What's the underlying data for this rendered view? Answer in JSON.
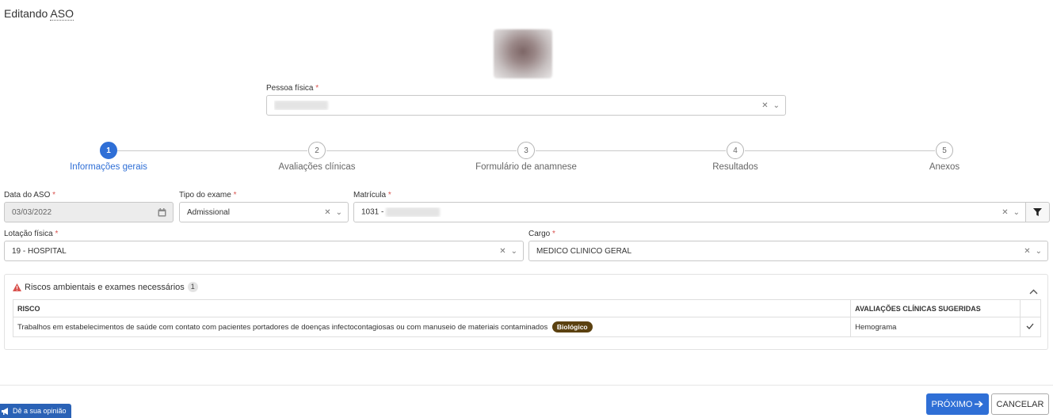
{
  "page": {
    "title_prefix": "Editando ",
    "title_acronym": "ASO"
  },
  "pessoa": {
    "label": "Pessoa física",
    "required": "*"
  },
  "steps": [
    {
      "number": "1",
      "label": "Informações gerais",
      "active": true
    },
    {
      "number": "2",
      "label": "Avaliações clínicas",
      "active": false
    },
    {
      "number": "3",
      "label": "Formulário de anamnese",
      "active": false
    },
    {
      "number": "4",
      "label": "Resultados",
      "active": false
    },
    {
      "number": "5",
      "label": "Anexos",
      "active": false
    }
  ],
  "form": {
    "data_aso": {
      "label": "Data do ASO",
      "value": "03/03/2022"
    },
    "tipo_exame": {
      "label": "Tipo do exame",
      "value": "Admissional"
    },
    "matricula": {
      "label": "Matrícula",
      "value": "1031 -"
    },
    "lotacao": {
      "label": "Lotação física",
      "value": "19 - HOSPITAL"
    },
    "cargo": {
      "label": "Cargo",
      "value": "MEDICO CLINICO GERAL"
    },
    "required_mark": "*"
  },
  "risks": {
    "title": "Riscos ambientais e exames necessários",
    "count": "1",
    "columns": {
      "risco": "RISCO",
      "avaliacoes": "AVALIAÇÕES CLÍNICAS SUGERIDAS"
    },
    "rows": [
      {
        "risco": "Trabalhos em estabelecimentos de saúde com contato com pacientes portadores de doenças infectocontagiosas ou com manuseio de materiais contaminados",
        "badge": "Biológico",
        "avaliacao": "Hemograma"
      }
    ]
  },
  "footer": {
    "next_label": "PRÓXIMO",
    "cancel_label": "CANCELAR",
    "feedback_label": "Dê a sua opinião"
  },
  "colors": {
    "primary": "#2f6fd6",
    "badge_bio": "#5b4110",
    "warning": "#d9534f",
    "feedback": "#2a62b6"
  },
  "icons": {
    "clear": "clear-x-icon",
    "dropdown": "chevron-down-icon",
    "calendar": "calendar-icon",
    "filter": "filter-icon",
    "warning": "warning-triangle-icon",
    "collapse": "chevron-up-icon",
    "check": "check-icon",
    "arrow": "arrow-right-icon",
    "megaphone": "megaphone-icon"
  }
}
